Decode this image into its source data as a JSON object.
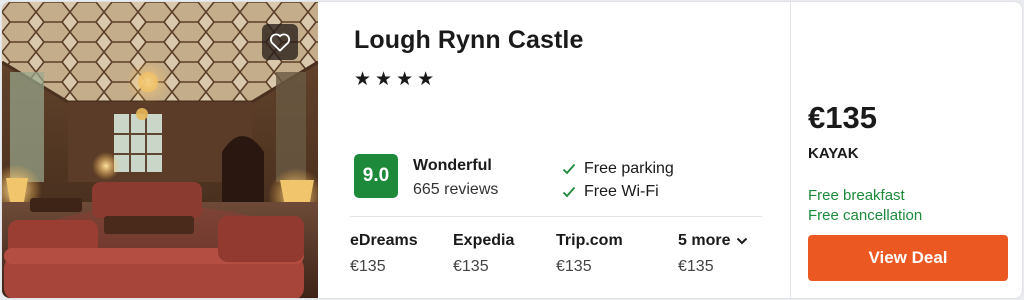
{
  "hotel": {
    "name": "Lough Rynn Castle",
    "star_count": 4,
    "star_glyph": "★"
  },
  "rating": {
    "score": "9.0",
    "label": "Wonderful",
    "reviews": "665 reviews",
    "badge_color": "#1d8a3b"
  },
  "amenities": [
    {
      "label": "Free parking",
      "icon": "check-icon"
    },
    {
      "label": "Free Wi-Fi",
      "icon": "check-icon"
    }
  ],
  "providers": [
    {
      "name": "eDreams",
      "price": "€135"
    },
    {
      "name": "Expedia",
      "price": "€135"
    },
    {
      "name": "Trip.com",
      "price": "€135"
    },
    {
      "name": "5 more",
      "price": "€135",
      "icon": "chevron-down-icon"
    }
  ],
  "deal": {
    "price": "€135",
    "source": "KAYAK",
    "perks": [
      "Free breakfast",
      "Free cancellation"
    ],
    "button_label": "View Deal",
    "button_color": "#ec5821",
    "perk_color": "#1d8a3b"
  },
  "photo": {
    "icon": "hotel-photo",
    "favorite_icon": "heart-icon"
  }
}
